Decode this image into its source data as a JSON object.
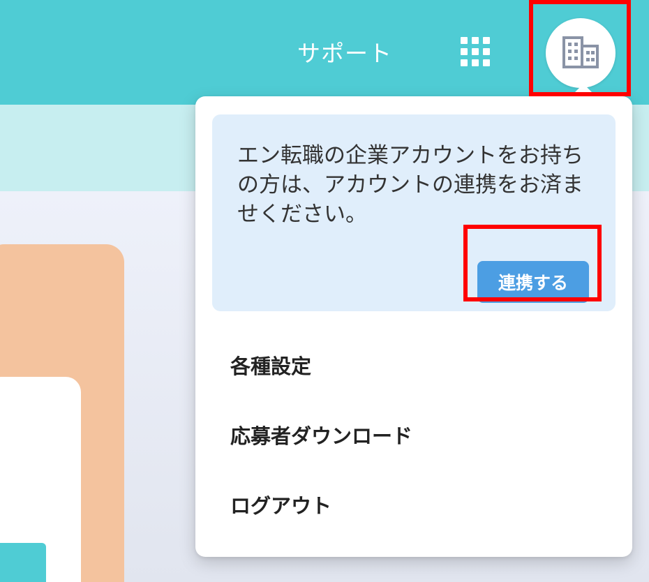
{
  "header": {
    "support_label": "サポート",
    "apps_icon": "grid-icon",
    "account_icon": "building-icon"
  },
  "dropdown": {
    "notice_text": "エン転職の企業アカウントをお持ちの方は、アカウントの連携をお済ませください。",
    "link_button_label": "連携する",
    "menu_items": [
      {
        "label": "各種設定"
      },
      {
        "label": "応募者ダウンロード"
      },
      {
        "label": "ログアウト"
      }
    ]
  },
  "colors": {
    "header_bg": "#4fccd4",
    "sub_band": "#c7eef0",
    "notice_bg": "#e0eefb",
    "button_bg": "#4c9ee3",
    "highlight": "#ff0000",
    "card_orange": "#f4c39e"
  }
}
